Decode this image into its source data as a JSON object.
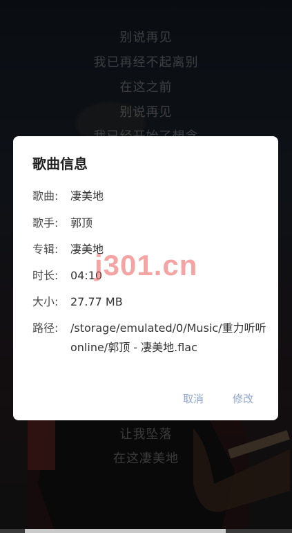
{
  "lyrics": {
    "lines_top": [
      "别说再见",
      "我已再经不起离别",
      "在这之前",
      "别说再见",
      "我已经开始了想念"
    ],
    "lines_bottom": [
      "让我坠落",
      "在这凄美地"
    ]
  },
  "dialog": {
    "title": "歌曲信息",
    "rows": [
      {
        "label": "歌曲:",
        "value": "凄美地"
      },
      {
        "label": "歌手:",
        "value": "郭顶"
      },
      {
        "label": "专辑:",
        "value": "凄美地"
      },
      {
        "label": "时长:",
        "value": "04:10"
      },
      {
        "label": "大小:",
        "value": "27.77 MB"
      },
      {
        "label": "路径:",
        "value": "/storage/emulated/0/Music/重力听听online/郭顶 - 凄美地.flac"
      }
    ],
    "cancel_label": "取消",
    "edit_label": "修改"
  },
  "watermark": {
    "text": "j301.cn",
    "color": "#ec5a5a"
  },
  "colors": {
    "accent": "#8fa6cf",
    "dialog_bg": "#ffffff",
    "background": "#151b23"
  }
}
